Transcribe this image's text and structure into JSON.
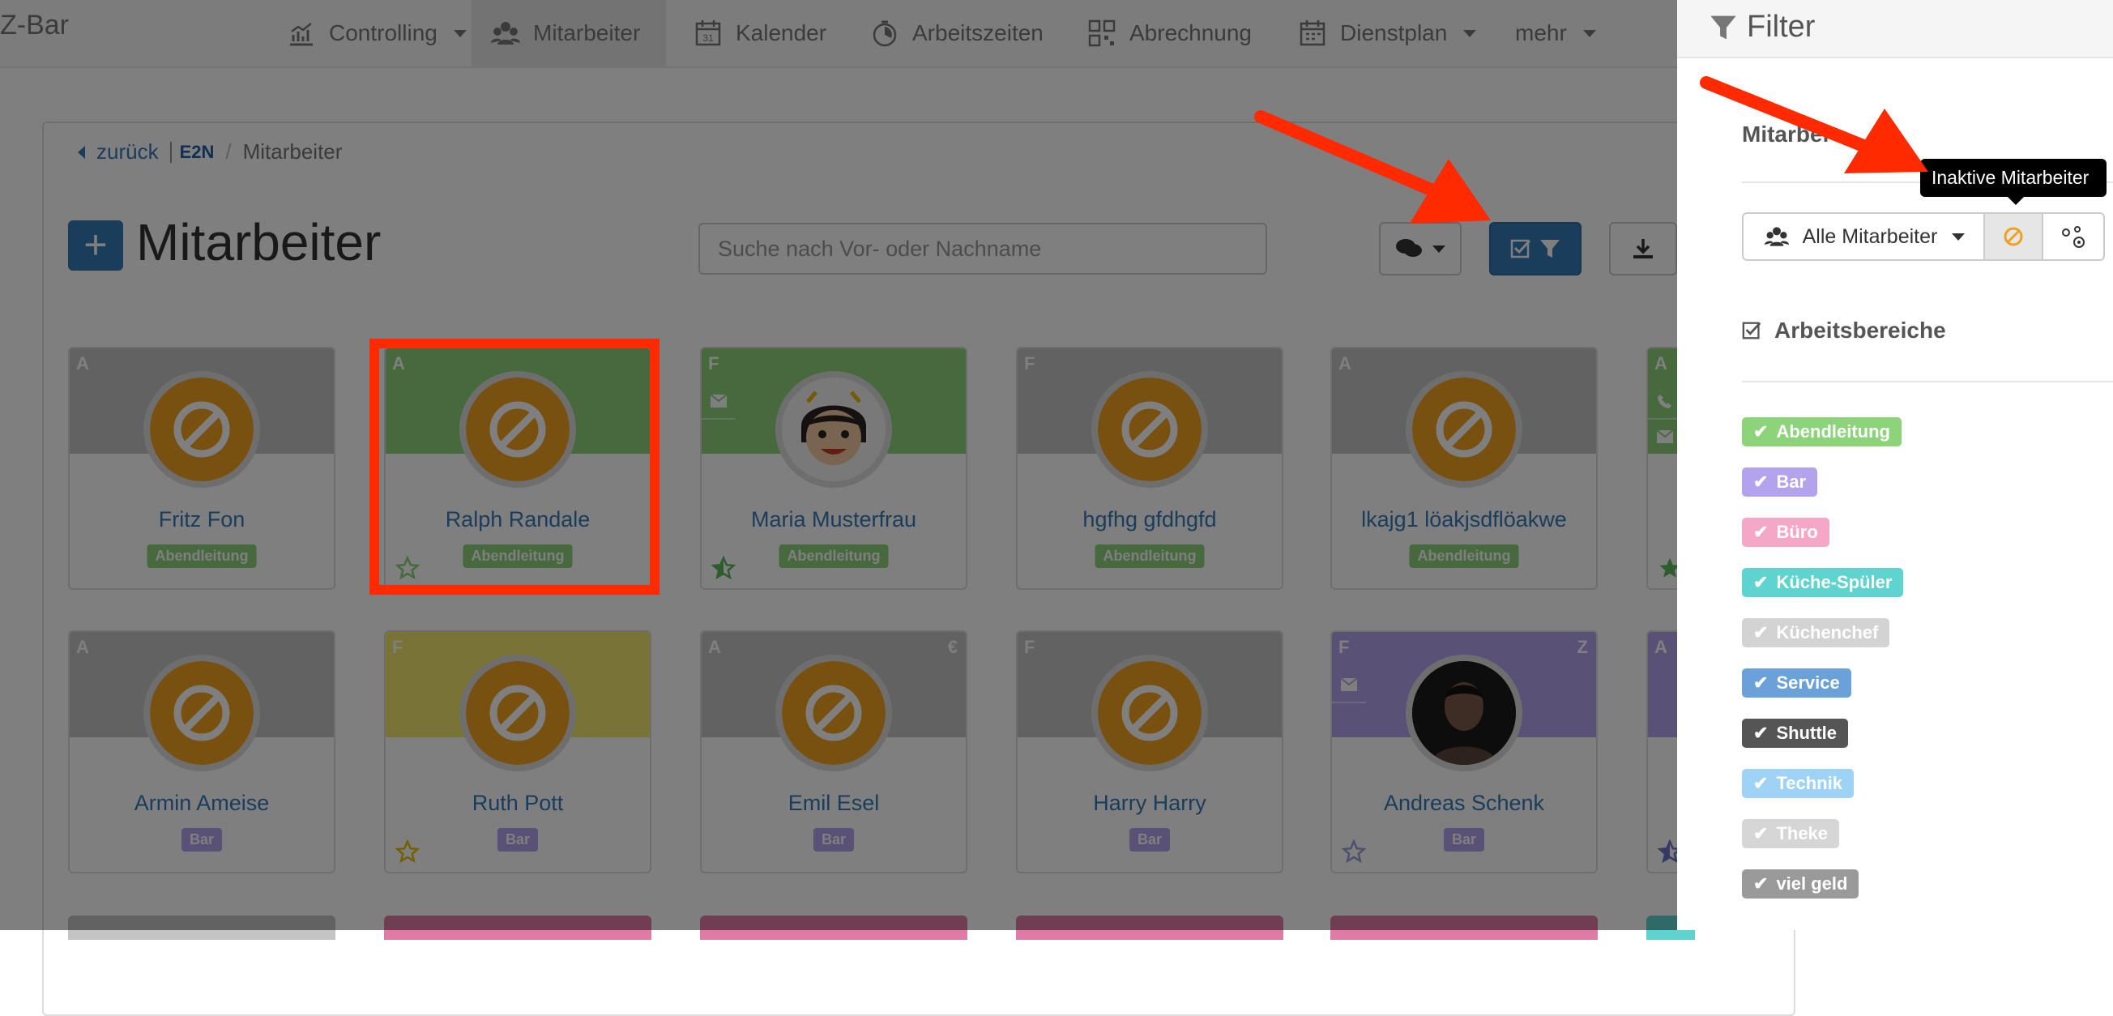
{
  "app": {
    "brand": "Z-Bar"
  },
  "nav": [
    {
      "label": "Controlling",
      "icon": "chart-icon",
      "dropdown": true
    },
    {
      "label": "Mitarbeiter",
      "icon": "users-icon",
      "dropdown": false,
      "active": true
    },
    {
      "label": "Kalender",
      "icon": "calendar-icon",
      "dropdown": false
    },
    {
      "label": "Arbeitszeiten",
      "icon": "stopwatch-icon",
      "dropdown": false
    },
    {
      "label": "Abrechnung",
      "icon": "grid-icon",
      "dropdown": false
    },
    {
      "label": "Dienstplan",
      "icon": "schedule-icon",
      "dropdown": true
    },
    {
      "label": "mehr",
      "icon": "",
      "dropdown": true
    }
  ],
  "breadcrumb": {
    "back": "zurück",
    "logo": "E2N",
    "current": "Mitarbeiter"
  },
  "page": {
    "title": "Mitarbeiter",
    "add_icon": "plus-icon"
  },
  "search": {
    "placeholder": "Suche nach Vor- oder Nachname",
    "value": ""
  },
  "toolbar": {
    "chat_icon": "comments-icon",
    "filter_icon": "filter-icon",
    "download_icon": "download-icon"
  },
  "colors": {
    "gray": "#c4c4c4",
    "green": "#8cd37a",
    "yellow": "#f2e86a",
    "purple": "#b3a2ec",
    "badge_green": "#8cd37a",
    "badge_purple": "#b3a2ec",
    "orange": "#f0a020",
    "primary": "#337ab7",
    "highlight": "#ff2a00"
  },
  "employees": [
    {
      "name": "Fritz Fon",
      "letter": "A",
      "badge": "Abendleitung",
      "avatar": "inactive-icon",
      "star": false
    },
    {
      "name": "Ralph Randale",
      "letter": "A",
      "badge": "Abendleitung",
      "avatar": "inactive-icon",
      "star": true
    },
    {
      "name": "Maria Musterfrau",
      "letter": "F",
      "badge": "Abendleitung",
      "avatar": "cartoon-girl-avatar",
      "star": true,
      "mail": true
    },
    {
      "name": "hgfhg gfdhgfd",
      "letter": "F",
      "badge": "Abendleitung",
      "avatar": "inactive-icon",
      "star": false
    },
    {
      "name": "lkajg1 löakjsdflöakwe",
      "letter": "A",
      "badge": "Abendleitung",
      "avatar": "inactive-icon",
      "star": false
    },
    {
      "name": "Armin Ameise",
      "letter": "A",
      "badge": "Bar",
      "avatar": "inactive-icon",
      "star": false
    },
    {
      "name": "Ruth Pott",
      "letter": "F",
      "badge": "Bar",
      "avatar": "inactive-icon",
      "star": true
    },
    {
      "name": "Emil Esel",
      "letter": "A",
      "right_letter": "€",
      "badge": "Bar",
      "avatar": "inactive-icon",
      "star": false
    },
    {
      "name": "Harry Harry",
      "letter": "F",
      "badge": "Bar",
      "avatar": "inactive-icon",
      "star": false
    },
    {
      "name": "Andreas Schenk",
      "letter": "F",
      "right_letter": "Z",
      "badge": "Bar",
      "avatar": "photo-avatar",
      "star": true,
      "mail": true
    }
  ],
  "partial_letters": [
    "A",
    "A"
  ],
  "filter": {
    "title": "Filter",
    "section_employees": "Mitarbei",
    "all_employees": "Alle Mitarbeiter",
    "tooltip": "Inaktive Mitarbeiter",
    "section_areas": "Arbeitsbereiche",
    "areas": [
      {
        "label": "Abendleitung",
        "color": "#8cd37a"
      },
      {
        "label": "Bar",
        "color": "#b3a2ec"
      },
      {
        "label": "Büro",
        "color": "#f4a7c6"
      },
      {
        "label": "Küche-Spüler",
        "color": "#5fd3d0"
      },
      {
        "label": "Küchenchef",
        "color": "#d3d3d3"
      },
      {
        "label": "Service",
        "color": "#6aa1d8"
      },
      {
        "label": "Shuttle",
        "color": "#555555"
      },
      {
        "label": "Technik",
        "color": "#9fd3f5"
      },
      {
        "label": "Theke",
        "color": "#d6d6d6"
      },
      {
        "label": "viel geld",
        "color": "#9a9a9a"
      }
    ]
  }
}
